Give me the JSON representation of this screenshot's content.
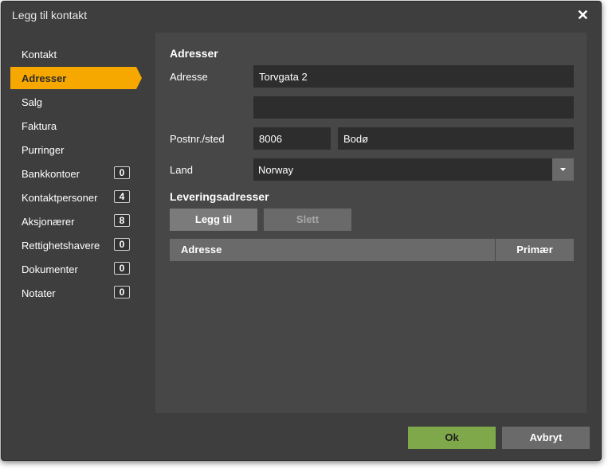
{
  "dialog": {
    "title": "Legg til kontakt",
    "close_icon": "close-icon"
  },
  "nav": {
    "items": [
      {
        "label": "Kontakt"
      },
      {
        "label": "Adresser",
        "active": true
      },
      {
        "label": "Salg"
      },
      {
        "label": "Faktura"
      },
      {
        "label": "Purringer"
      },
      {
        "label": "Bankkontoer",
        "count": "0"
      },
      {
        "label": "Kontaktpersoner",
        "count": "4"
      },
      {
        "label": "Aksjonærer",
        "count": "8"
      },
      {
        "label": "Rettighetshavere",
        "count": "0"
      },
      {
        "label": "Dokumenter",
        "count": "0"
      },
      {
        "label": "Notater",
        "count": "0"
      }
    ],
    "active_color": "#f7a800"
  },
  "form": {
    "heading": "Adresser",
    "address_label": "Adresse",
    "address_line1": "Torvgata 2",
    "address_line2": "",
    "postal_label": "Postnr./sted",
    "postal_code": "8006",
    "city": "Bodø",
    "country_label": "Land",
    "country_value": "Norway"
  },
  "delivery": {
    "heading": "Leveringsadresser",
    "add_label": "Legg til",
    "delete_label": "Slett",
    "columns": [
      "Adresse",
      "Primær"
    ],
    "rows": []
  },
  "footer": {
    "ok_label": "Ok",
    "cancel_label": "Avbryt",
    "ok_color": "#7fa84a"
  }
}
